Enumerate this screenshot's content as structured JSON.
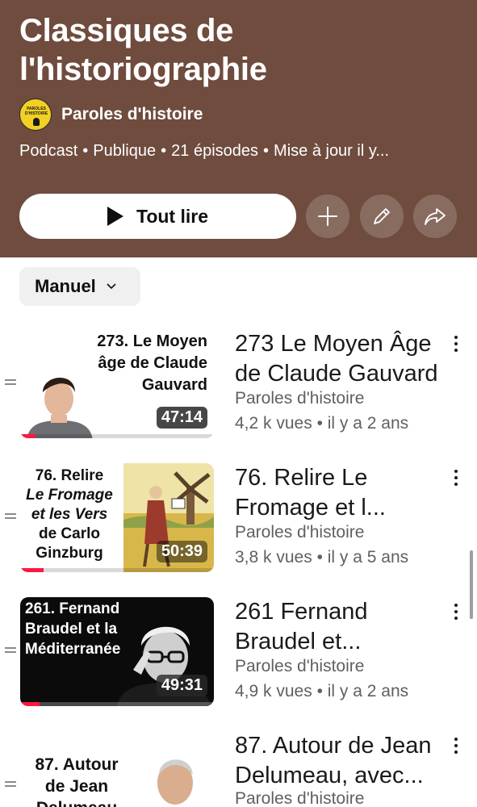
{
  "playlist": {
    "title": "Classiques de l'historiographie",
    "channel": "Paroles d'histoire",
    "channel_logo_text": "PAROLES D'HISTOIRE",
    "meta": [
      "Podcast",
      "Publique",
      "21 épisodes",
      "Mise à jour il y..."
    ]
  },
  "actions": {
    "play_all_label": "Tout lire",
    "add_icon": "plus-icon",
    "edit_icon": "pencil-icon",
    "share_icon": "share-icon"
  },
  "sort": {
    "label": "Manuel"
  },
  "videos": [
    {
      "thumb_text": [
        "273. Le Moyen",
        "âge de Claude",
        "Gauvard"
      ],
      "duration": "47:14",
      "title": "273  Le Moyen Âge de Claude Gauvard",
      "channel": "Paroles d'histoire",
      "views": "4,2 k vues",
      "age": "il y a 2 ans",
      "watched_fraction": 0.08
    },
    {
      "thumb_text": [
        "76. Relire",
        "Le Fromage",
        "et les Vers",
        "de Carlo",
        "Ginzburg"
      ],
      "duration": "50:39",
      "title": "76. Relire Le Fromage et l...",
      "channel": "Paroles d'histoire",
      "views": "3,8 k vues",
      "age": "il y a 5 ans",
      "watched_fraction": 0.12
    },
    {
      "thumb_text": [
        "261. Fernand",
        "Braudel et la",
        "Méditerranée"
      ],
      "duration": "49:31",
      "title": "261 Fernand Braudel et...",
      "channel": "Paroles d'histoire",
      "views": "4,9 k vues",
      "age": "il y a 2 ans",
      "watched_fraction": 0.1
    },
    {
      "thumb_text": [
        "87. Autour",
        "de Jean",
        "Delumeau"
      ],
      "duration": "",
      "title": "87. Autour de Jean Delumeau, avec...",
      "channel": "Paroles d'histoire",
      "views": "",
      "age": ""
    }
  ],
  "colors": {
    "header_bg": "#6f4c3e",
    "progress_red": "#ff1744",
    "muted_text": "#606060"
  }
}
